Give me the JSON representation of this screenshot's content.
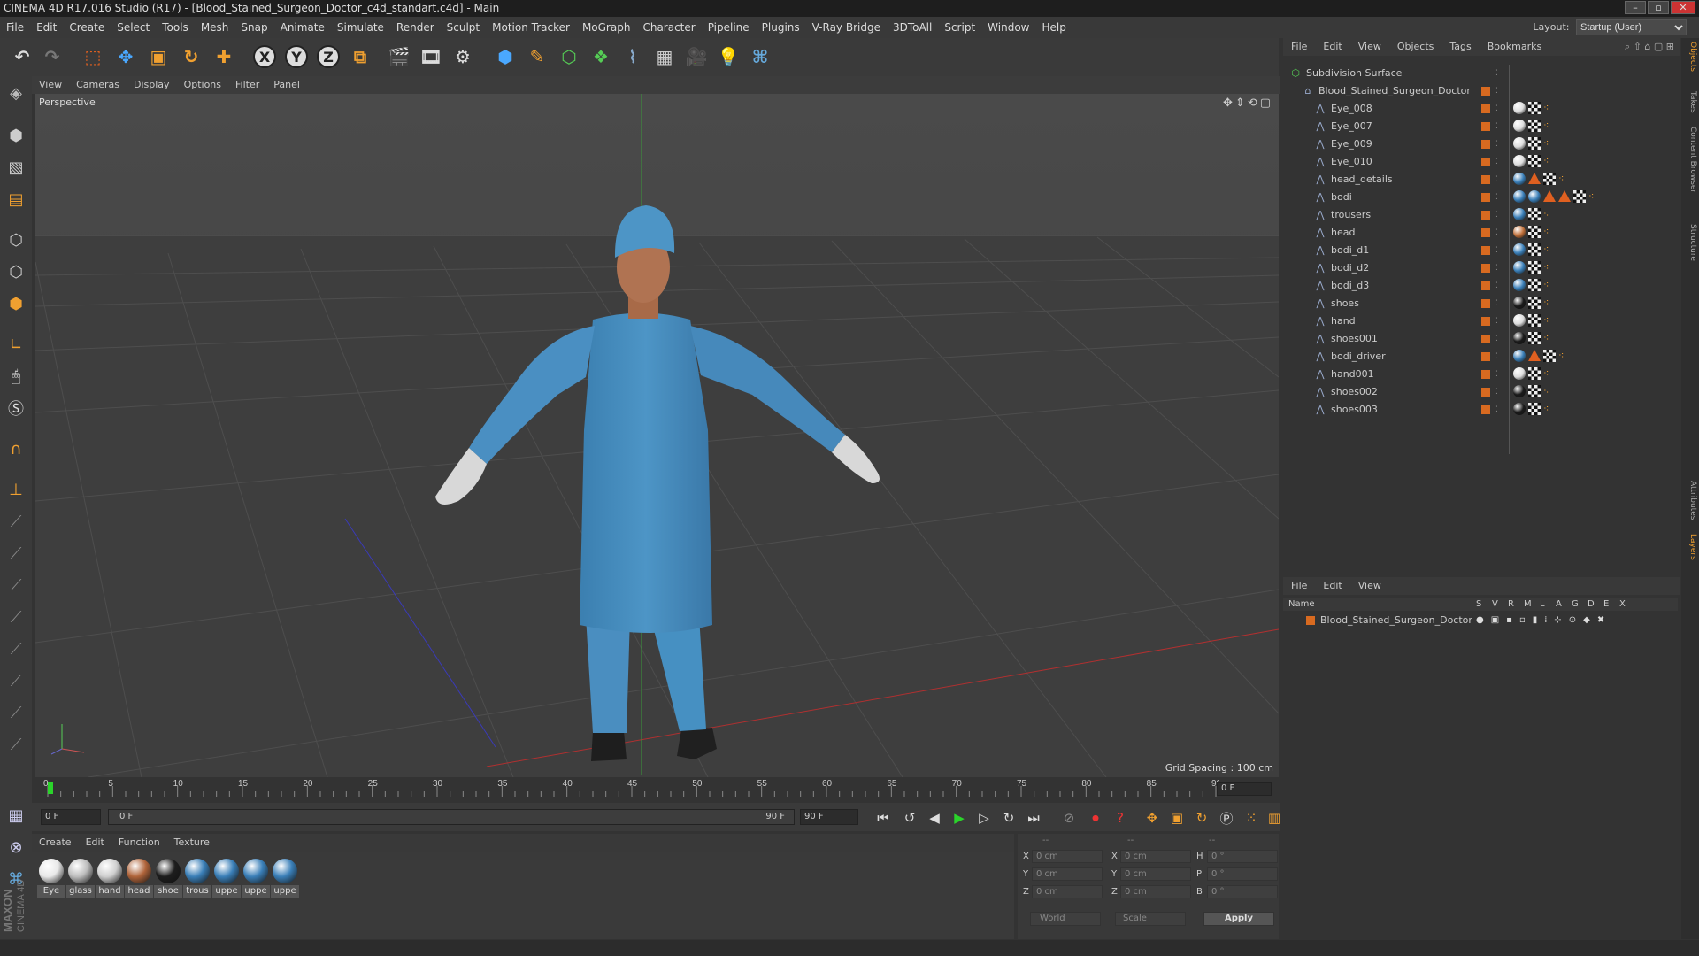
{
  "window": {
    "title": "CINEMA 4D R17.016 Studio (R17) - [Blood_Stained_Surgeon_Doctor_c4d_standart.c4d] - Main"
  },
  "menu": [
    "File",
    "Edit",
    "Create",
    "Select",
    "Tools",
    "Mesh",
    "Snap",
    "Animate",
    "Simulate",
    "Render",
    "Sculpt",
    "Motion Tracker",
    "MoGraph",
    "Character",
    "Pipeline",
    "Plugins",
    "V-Ray Bridge",
    "3DToAll",
    "Script",
    "Window",
    "Help"
  ],
  "layout": {
    "label": "Layout:",
    "value": "Startup (User)"
  },
  "toolbar": {
    "x_label": "X",
    "y_label": "Y",
    "z_label": "Z"
  },
  "viewport": {
    "menu": [
      "View",
      "Cameras",
      "Display",
      "Options",
      "Filter",
      "Panel"
    ],
    "label": "Perspective",
    "grid_spacing": "Grid Spacing : 100 cm"
  },
  "timeline": {
    "ticks": [
      "0",
      "5",
      "10",
      "15",
      "20",
      "25",
      "30",
      "35",
      "40",
      "45",
      "50",
      "55",
      "60",
      "65",
      "70",
      "75",
      "80",
      "85",
      "90"
    ],
    "current_frame": "0 F"
  },
  "transport": {
    "start": "0 F",
    "range_start": "0 F",
    "range_end": "90 F",
    "end": "90 F"
  },
  "materials": {
    "menu": [
      "Create",
      "Edit",
      "Function",
      "Texture"
    ],
    "items": [
      {
        "name": "Eye",
        "color": "#e8e8e8"
      },
      {
        "name": "glass",
        "color": "#bdbdbd"
      },
      {
        "name": "hand",
        "color": "#cfcfcf"
      },
      {
        "name": "head",
        "color": "#b0643a"
      },
      {
        "name": "shoe",
        "color": "#1d1d1d"
      },
      {
        "name": "trous",
        "color": "#3a7fb8"
      },
      {
        "name": "uppe",
        "color": "#3a7fb8"
      },
      {
        "name": "uppe",
        "color": "#3a7fb8"
      },
      {
        "name": "uppe",
        "color": "#3a7fb8"
      }
    ]
  },
  "coords": {
    "headers": [
      "--",
      "--",
      "--"
    ],
    "rows": [
      {
        "l1": "X",
        "v1": "0 cm",
        "l2": "X",
        "v2": "0 cm",
        "l3": "H",
        "v3": "0 °"
      },
      {
        "l1": "Y",
        "v1": "0 cm",
        "l2": "Y",
        "v2": "0 cm",
        "l3": "P",
        "v3": "0 °"
      },
      {
        "l1": "Z",
        "v1": "0 cm",
        "l2": "Z",
        "v2": "0 cm",
        "l3": "B",
        "v3": "0 °"
      }
    ],
    "world": "World",
    "scale": "Scale",
    "apply": "Apply"
  },
  "object_manager": {
    "menu": [
      "File",
      "Edit",
      "View",
      "Objects",
      "Tags",
      "Bookmarks"
    ],
    "objects": [
      {
        "name": "Subdivision Surface",
        "level": 0,
        "tags": []
      },
      {
        "name": "Blood_Stained_Surgeon_Doctor",
        "level": 1,
        "tags": []
      },
      {
        "name": "Eye_008",
        "level": 2,
        "tags": [
          "ball-white",
          "checker",
          "dots"
        ]
      },
      {
        "name": "Eye_007",
        "level": 2,
        "tags": [
          "ball-white",
          "checker",
          "dots"
        ]
      },
      {
        "name": "Eye_009",
        "level": 2,
        "tags": [
          "ball-white",
          "checker",
          "dots"
        ]
      },
      {
        "name": "Eye_010",
        "level": 2,
        "tags": [
          "ball-white",
          "checker",
          "dots"
        ]
      },
      {
        "name": "head_details",
        "level": 2,
        "tags": [
          "ball-blue",
          "tri",
          "checker",
          "dots"
        ]
      },
      {
        "name": "bodi",
        "level": 2,
        "tags": [
          "ball-blue",
          "ball-blue",
          "tri",
          "tri",
          "checker",
          "dots"
        ]
      },
      {
        "name": "trousers",
        "level": 2,
        "tags": [
          "ball-blue",
          "checker",
          "dots"
        ]
      },
      {
        "name": "head",
        "level": 2,
        "tags": [
          "ball-orange",
          "checker",
          "dots"
        ]
      },
      {
        "name": "bodi_d1",
        "level": 2,
        "tags": [
          "ball-blue",
          "checker",
          "dots"
        ]
      },
      {
        "name": "bodi_d2",
        "level": 2,
        "tags": [
          "ball-blue",
          "checker",
          "dots"
        ]
      },
      {
        "name": "bodi_d3",
        "level": 2,
        "tags": [
          "ball-blue",
          "checker",
          "dots"
        ]
      },
      {
        "name": "shoes",
        "level": 2,
        "tags": [
          "ball-black",
          "checker",
          "dots"
        ]
      },
      {
        "name": "hand",
        "level": 2,
        "tags": [
          "ball-white",
          "checker",
          "dots"
        ]
      },
      {
        "name": "shoes001",
        "level": 2,
        "tags": [
          "ball-black",
          "checker",
          "dots"
        ]
      },
      {
        "name": "bodi_driver",
        "level": 2,
        "tags": [
          "ball-blue",
          "tri",
          "checker",
          "dots"
        ]
      },
      {
        "name": "hand001",
        "level": 2,
        "tags": [
          "ball-white",
          "checker",
          "dots"
        ]
      },
      {
        "name": "shoes002",
        "level": 2,
        "tags": [
          "ball-black",
          "checker",
          "dots"
        ]
      },
      {
        "name": "shoes003",
        "level": 2,
        "tags": [
          "ball-black",
          "checker",
          "dots"
        ]
      }
    ]
  },
  "layer_manager": {
    "menu": [
      "File",
      "Edit",
      "View"
    ],
    "name_header": "Name",
    "columns": [
      "S",
      "V",
      "R",
      "M",
      "L",
      "A",
      "G",
      "D",
      "E",
      "X"
    ],
    "layers": [
      {
        "name": "Blood_Stained_Surgeon_Doctor"
      }
    ]
  },
  "side_tabs": [
    "Objects",
    "Takes",
    "Content Browser",
    "Structure",
    "Attributes",
    "Layers"
  ],
  "colors": {
    "accent": "#d86a20",
    "scrub": "#2bd42b"
  }
}
